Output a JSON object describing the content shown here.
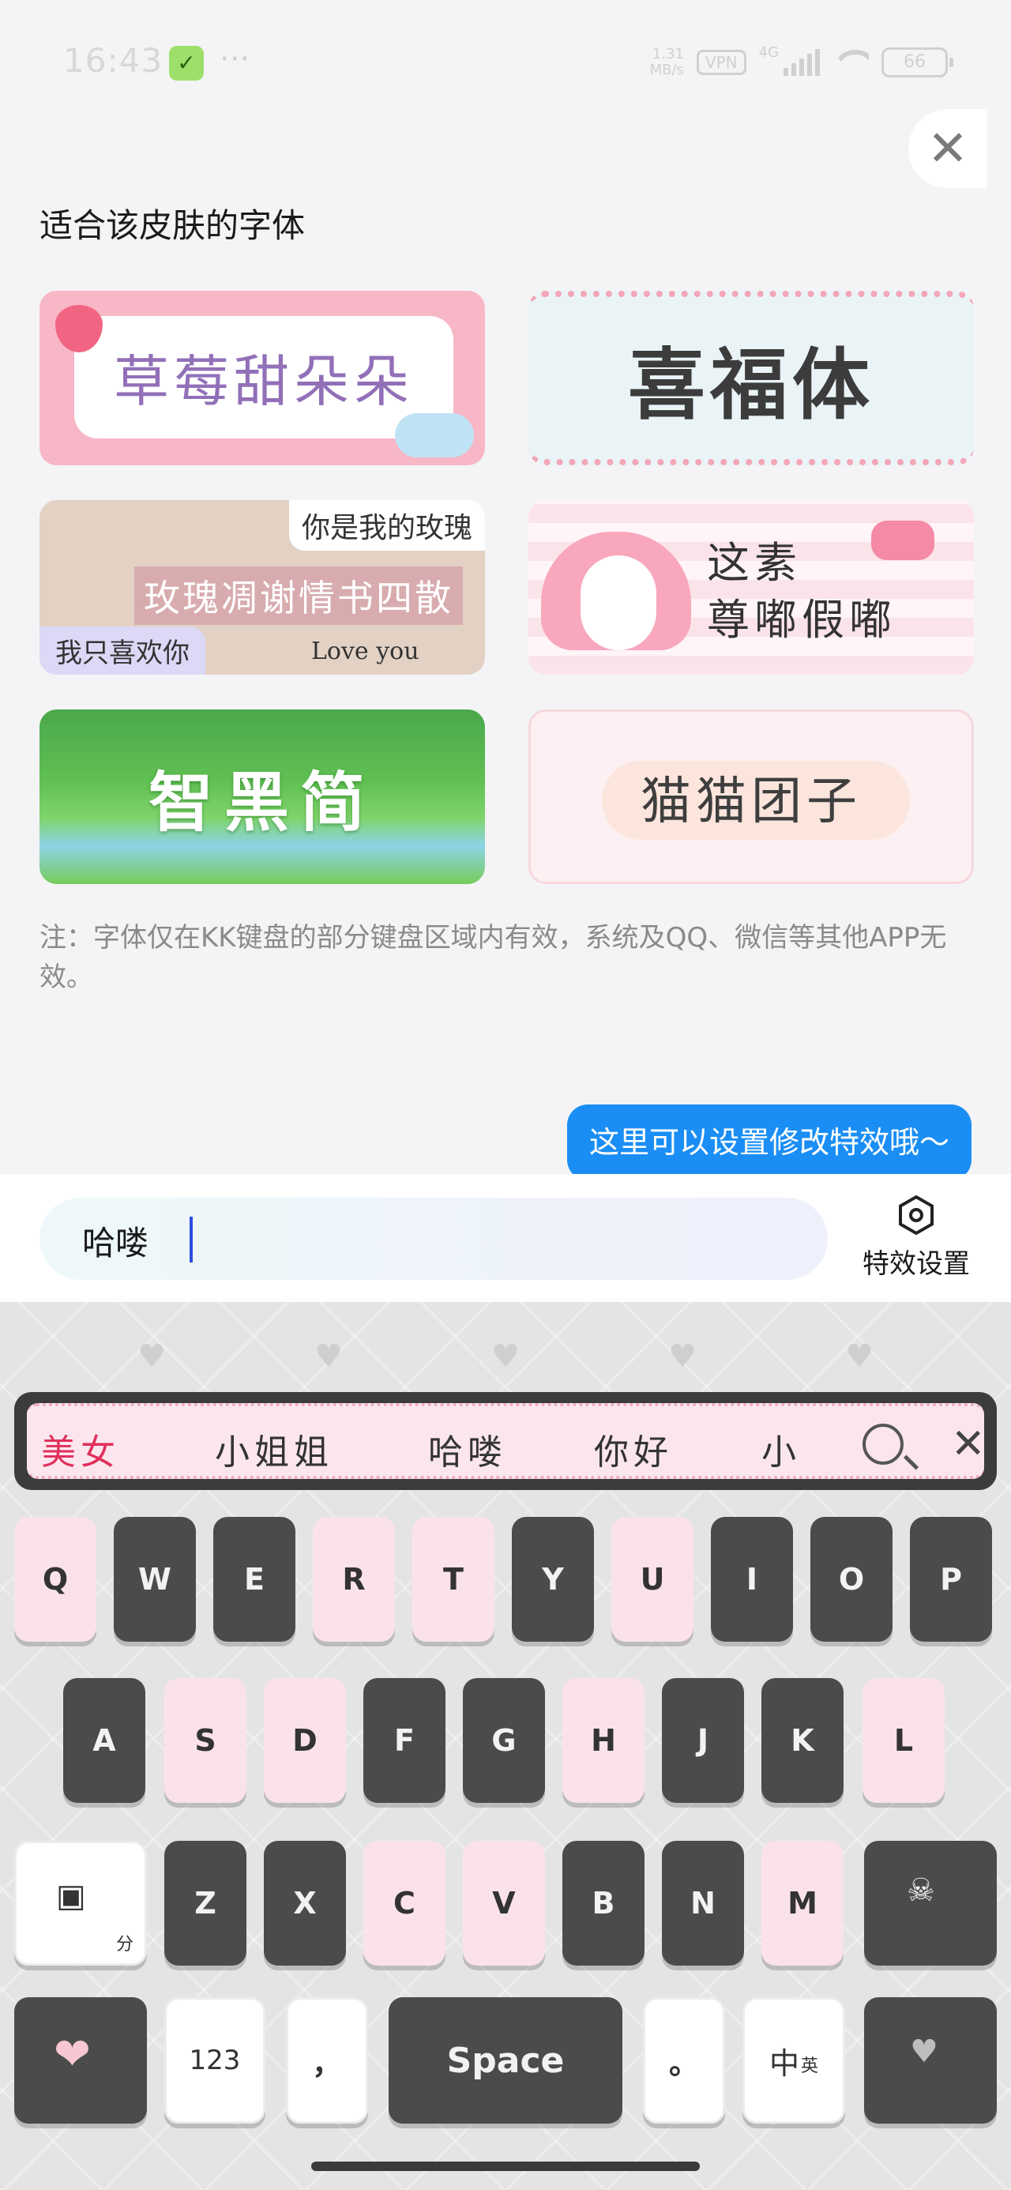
{
  "status": {
    "time": "16:43",
    "speed_value": "1.31",
    "speed_unit": "MB/s",
    "vpn": "VPN",
    "network": "4G",
    "battery": "66"
  },
  "panel": {
    "section_title": "适合该皮肤的字体",
    "fonts": [
      {
        "name": "草莓甜朵朵"
      },
      {
        "name": "喜福体"
      },
      {
        "tag_top": "你是我的玫瑰",
        "middle": "玫瑰凋谢情书四散",
        "tag_bottom": "我只喜欢你",
        "extra": "Love you"
      },
      {
        "line1": "这素",
        "line2": "尊嘟假嘟"
      },
      {
        "name": "智黑简"
      },
      {
        "name": "猫猫团子"
      }
    ],
    "note": "注：字体仅在KK键盘的部分键盘区域内有效，系统及QQ、微信等其他APP无效。"
  },
  "tooltip": "这里可以设置修改特效哦～",
  "input": {
    "value": "哈喽",
    "effect_settings_label": "特效设置"
  },
  "keyboard": {
    "candidates": [
      "美女",
      "小姐姐",
      "哈喽",
      "你好",
      "小"
    ],
    "row1": [
      "Q",
      "W",
      "E",
      "R",
      "T",
      "Y",
      "U",
      "I",
      "O",
      "P"
    ],
    "row2": [
      "A",
      "S",
      "D",
      "F",
      "G",
      "H",
      "J",
      "K",
      "L"
    ],
    "row3": [
      "Z",
      "X",
      "C",
      "V",
      "B",
      "N",
      "M"
    ],
    "num_key": "123",
    "comma_key": "，",
    "space_key": "Space",
    "period_key": "。",
    "lang_key_main": "中",
    "lang_key_sub": "英",
    "heart_symbol": "♥",
    "shift_sub": "分"
  },
  "colors": {
    "accent_blue": "#1a8ef5",
    "key_dark": "#4b4b4b",
    "key_pink": "#fbe2ea",
    "candidate_highlight": "#e0305a"
  }
}
